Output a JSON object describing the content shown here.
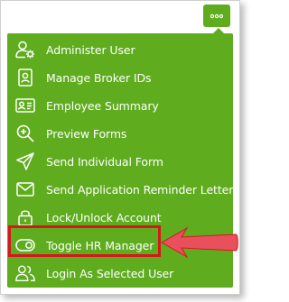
{
  "more_button": {
    "icon": "ellipsis-icon"
  },
  "menu": {
    "items": [
      {
        "label": "Administer User",
        "icon": "user-gear-icon"
      },
      {
        "label": "Manage Broker IDs",
        "icon": "id-badge-icon"
      },
      {
        "label": "Employee Summary",
        "icon": "id-card-icon"
      },
      {
        "label": "Preview Forms",
        "icon": "magnifier-plus-icon"
      },
      {
        "label": "Send Individual Form",
        "icon": "paper-plane-icon"
      },
      {
        "label": "Send Application Reminder Letter",
        "icon": "envelope-icon"
      },
      {
        "label": "Lock/Unlock Account",
        "icon": "lock-icon"
      },
      {
        "label": "Toggle HR Manager",
        "icon": "toggle-icon"
      },
      {
        "label": "Login As Selected User",
        "icon": "users-icon"
      }
    ]
  },
  "colors": {
    "menu_background": "#5fac1f",
    "highlight": "#d6171b",
    "arrow": "#e94f5c"
  }
}
